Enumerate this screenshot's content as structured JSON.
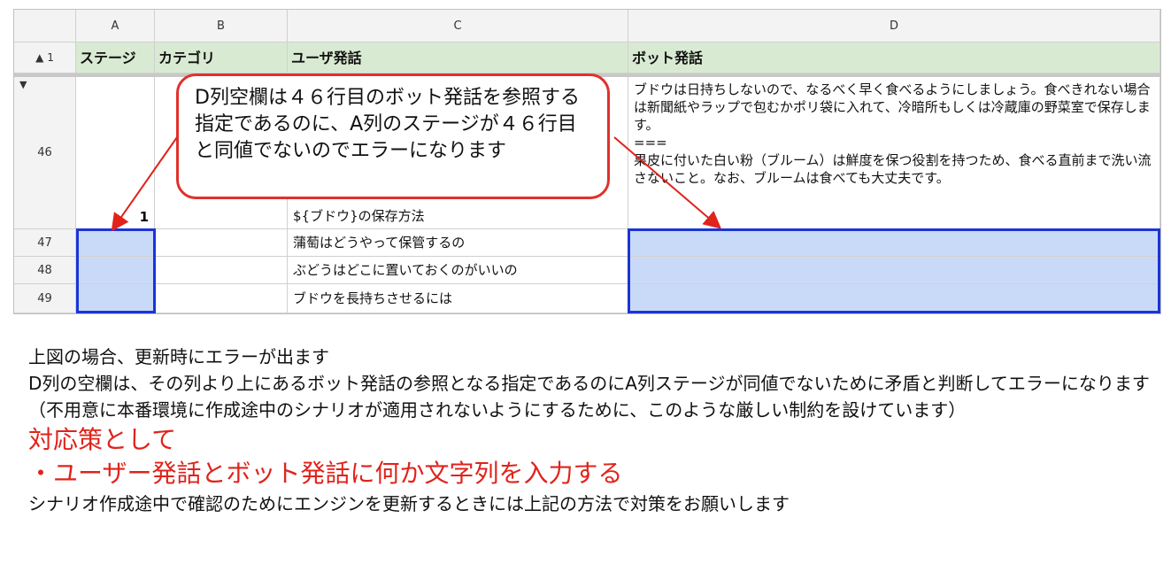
{
  "sheet": {
    "col_letters": [
      "A",
      "B",
      "C",
      "D"
    ],
    "row_header_1": "▲ 1",
    "header": {
      "a": "ステージ",
      "b": "カテゴリ",
      "c": "ユーザ発話",
      "d": "ボット発話"
    },
    "row46": {
      "num": "46",
      "a": "1",
      "c": "${ブドウ}の保存方法",
      "d": "ブドウは日持ちしないので、なるべく早く食べるようにしましょう。食べきれない場合は新聞紙やラップで包むかポリ袋に入れて、冷暗所もしくは冷蔵庫の野菜室で保存します。\n===\n果皮に付いた白い粉（ブルーム）は鮮度を保つ役割を持つため、食べる直前まで洗い流さないこと。なお、ブルームは食べても大丈夫です。"
    },
    "rows": [
      {
        "num": "47",
        "c": "蒲萄はどうやって保管するの"
      },
      {
        "num": "48",
        "c": "ぶどうはどこに置いておくのがいいの"
      },
      {
        "num": "49",
        "c": "ブドウを長持ちさせるには"
      }
    ]
  },
  "callout": {
    "text": "D列空欄は４６行目のボット発話を参照する指定であるのに、A列のステージが４６行目と同値でないのでエラーになります"
  },
  "description": {
    "line1": "上図の場合、更新時にエラーが出ます",
    "line2": "D列の空欄は、その列より上にあるボット発話の参照となる指定であるのにA列ステージが同値でないために矛盾と判断してエラーになります（不用意に本番環境に作成途中のシナリオが適用されないようにするために、このような厳しい制約を設けています）",
    "heading": "対応策として",
    "bullet": "・ユーザー発話とボット発話に何か文字列を入力する",
    "footer": "シナリオ作成途中で確認のためにエンジンを更新するときには上記の方法で対策をお願いします"
  },
  "colors": {
    "header_green": "#d9ead3",
    "selection": "#c9daf8",
    "selection_border": "#1a35d6",
    "callout_red": "#e0312b"
  }
}
